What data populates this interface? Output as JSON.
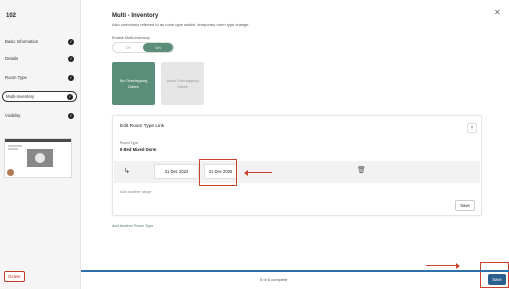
{
  "sidebar": {
    "property_title": "102",
    "items": [
      {
        "label": "Basic Information",
        "status": "complete"
      },
      {
        "label": "Details",
        "status": "complete"
      },
      {
        "label": "Room Type",
        "status": "complete"
      },
      {
        "label": "Multi-Inventory",
        "status": "complete",
        "active": true
      },
      {
        "label": "Visibility",
        "status": "complete"
      }
    ],
    "delete_label": "Delete"
  },
  "main": {
    "title": "Multi - Inventory",
    "subtitle": "Also commonly referred to as room type switch, temporary room type change.",
    "enable_label": "Enable Multi-Inventory",
    "toggle": {
      "off_label": "Off",
      "on_label": "On",
      "selected": "On"
    },
    "modes": [
      {
        "label": "No Overlapping Dates",
        "selected": true
      },
      {
        "label": "Allow Overlapping Dates",
        "selected": false
      }
    ],
    "card": {
      "title": "Edit Room Type Link",
      "room_type_label": "Room Type",
      "room_type_value": "8 Bed Mixed Dorm",
      "date_from": "31 Dec 2022",
      "date_to": "31 Dec 2025",
      "add_range_label": "Add another range",
      "save_label": "Save",
      "close_symbol": "×"
    },
    "add_room_type_label": "Add Another Room Type"
  },
  "footer": {
    "progress_text": "5 of 5 complete",
    "progress_fraction": 1.0,
    "save_label": "Save"
  },
  "colors": {
    "accent_green": "#5b8e78",
    "primary_blue": "#2b5f8e",
    "annotation_red": "#c7432b"
  }
}
